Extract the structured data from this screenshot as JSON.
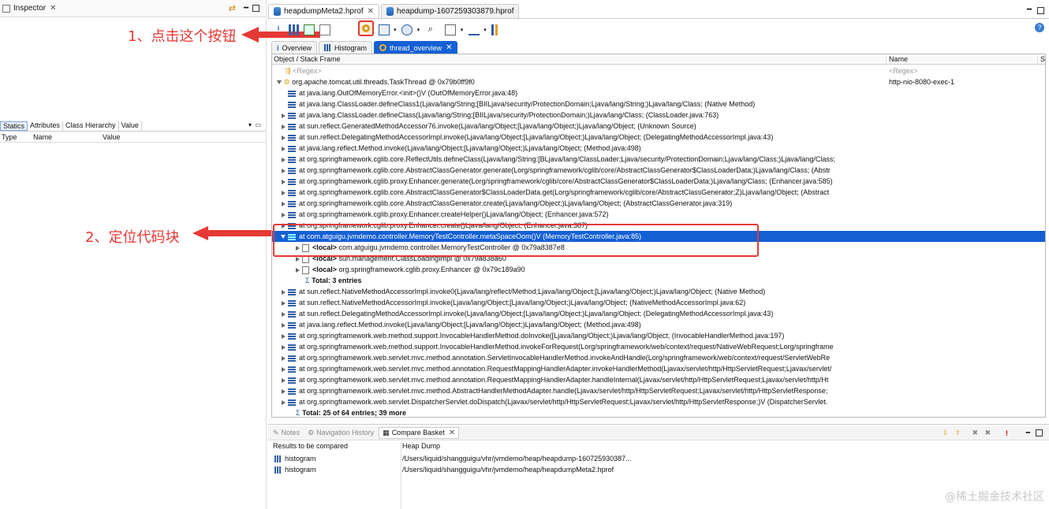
{
  "inspector": {
    "title": "Inspector",
    "tabs": [
      "Statics",
      "Attributes",
      "Class Hierarchy",
      "Value"
    ],
    "columns": [
      "Type",
      "Name",
      "Value"
    ]
  },
  "editor": {
    "file_tabs": [
      "heapdumpMeta2.hprof",
      "heapdump-1607259303879.hprof"
    ],
    "view_tabs": [
      "Overview",
      "Histogram",
      "thread_overview"
    ],
    "columns": {
      "object": "Object / Stack Frame",
      "name": "Name",
      "extra": "S"
    },
    "regex_placeholder": "<Regex>",
    "regex_name_placeholder": "<Regex>",
    "thread": {
      "label": "org.apache.tomcat.util.threads.TaskThread @ 0x79b0ff9f0",
      "name": "http-nio-8080-exec-1"
    },
    "frames_before": [
      "at java.lang.OutOfMemoryError.<init>()V (OutOfMemoryError.java:48)",
      "at java.lang.ClassLoader.defineClass1(Ljava/lang/String;[BIILjava/security/ProtectionDomain;Ljava/lang/String;)Ljava/lang/Class; (Native Method)",
      "at java.lang.ClassLoader.defineClass(Ljava/lang/String;[BIILjava/security/ProtectionDomain;)Ljava/lang/Class; (ClassLoader.java:763)",
      "at sun.reflect.GeneratedMethodAccessor76.invoke(Ljava/lang/Object;[Ljava/lang/Object;)Ljava/lang/Object; (Unknown Source)",
      "at sun.reflect.DelegatingMethodAccessorImpl.invoke(Ljava/lang/Object;[Ljava/lang/Object;)Ljava/lang/Object; (DelegatingMethodAccessorImpl.java:43)",
      "at java.lang.reflect.Method.invoke(Ljava/lang/Object;[Ljava/lang/Object;)Ljava/lang/Object; (Method.java:498)",
      "at org.springframework.cglib.core.ReflectUtils.defineClass(Ljava/lang/String;[BLjava/lang/ClassLoader;Ljava/security/ProtectionDomain;Ljava/lang/Class;)Ljava/lang/Class;",
      "at org.springframework.cglib.core.AbstractClassGenerator.generate(Lorg/springframework/cglib/core/AbstractClassGenerator$ClassLoaderData;)Ljava/lang/Class; (Abstr",
      "at org.springframework.cglib.proxy.Enhancer.generate(Lorg/springframework/cglib/core/AbstractClassGenerator$ClassLoaderData;)Ljava/lang/Class; (Enhancer.java:585)",
      "at org.springframework.cglib.core.AbstractClassGenerator$ClassLoaderData.get(Lorg/springframework/cglib/core/AbstractClassGenerator;Z)Ljava/lang/Object; (Abstract",
      "at org.springframework.cglib.core.AbstractClassGenerator.create(Ljava/lang/Object;)Ljava/lang/Object; (AbstractClassGenerator.java:319)",
      "at org.springframework.cglib.proxy.Enhancer.createHelper()Ljava/lang/Object; (Enhancer.java:572)",
      "at org.springframework.cglib.proxy.Enhancer.create()Ljava/lang/Object; (Enhancer.java:387)"
    ],
    "selected_frame": "at com.atguigu.jvmdemo.controller.MemoryTestController.metaSpaceOom()V (MemoryTestController.java:85)",
    "locals": [
      {
        "tag": "<local>",
        "text": "com.atguigu.jvmdemo.controller.MemoryTestController @ 0x79a8387e8"
      },
      {
        "tag": "<local>",
        "text": "sun.management.ClassLoadingImpl @ 0x79a838a60"
      },
      {
        "tag": "<local>",
        "text": "org.springframework.cglib.proxy.Enhancer @ 0x79c189a90"
      }
    ],
    "locals_total": "Total: 3 entries",
    "frames_after": [
      "at sun.reflect.NativeMethodAccessorImpl.invoke0(Ljava/lang/reflect/Method;Ljava/lang/Object;[Ljava/lang/Object;)Ljava/lang/Object; (Native Method)",
      "at sun.reflect.NativeMethodAccessorImpl.invoke(Ljava/lang/Object;[Ljava/lang/Object;)Ljava/lang/Object; (NativeMethodAccessorImpl.java:62)",
      "at sun.reflect.DelegatingMethodAccessorImpl.invoke(Ljava/lang/Object;[Ljava/lang/Object;)Ljava/lang/Object; (DelegatingMethodAccessorImpl.java:43)",
      "at java.lang.reflect.Method.invoke(Ljava/lang/Object;[Ljava/lang/Object;)Ljava/lang/Object; (Method.java:498)",
      "at org.springframework.web.method.support.InvocableHandlerMethod.doInvoke([Ljava/lang/Object;)Ljava/lang/Object; (InvocableHandlerMethod.java:197)",
      "at org.springframework.web.method.support.InvocableHandlerMethod.invokeForRequest(Lorg/springframework/web/context/request/NativeWebRequest;Lorg/springframe",
      "at org.springframework.web.servlet.mvc.method.annotation.ServletInvocableHandlerMethod.invokeAndHandle(Lorg/springframework/web/context/request/ServletWebRe",
      "at org.springframework.web.servlet.mvc.method.annotation.RequestMappingHandlerAdapter.invokeHandlerMethod(Ljavax/servlet/http/HttpServletRequest;Ljavax/servlet/",
      "at org.springframework.web.servlet.mvc.method.annotation.RequestMappingHandlerAdapter.handleInternal(Ljavax/servlet/http/HttpServletRequest;Ljavax/servlet/http/Ht",
      "at org.springframework.web.servlet.mvc.method.AbstractHandlerMethodAdapter.handle(Ljavax/servlet/http/HttpServletRequest;Ljavax/servlet/http/HttpServletResponse;",
      "at org.springframework.web.servlet.DispatcherServlet.doDispatch(Ljavax/servlet/http/HttpServletRequest;Ljavax/servlet/http/HttpServletResponse;)V (DispatcherServlet."
    ],
    "frames_total": "Total: 25 of 64 entries; 39 more"
  },
  "bottom": {
    "tabs": [
      "Notes",
      "Navigation History",
      "Compare Basket"
    ],
    "columns": [
      "Results to be compared",
      "Heap Dump"
    ],
    "rows": [
      {
        "name": "histogram",
        "path": "/Users/liquid/shangguigu/vhr/jvmdemo/heap/heapdump-160725930387..."
      },
      {
        "name": "histogram",
        "path": "/Users/liquid/shangguigu/vhr/jvmdemo/heap/heapdumpMeta2.hprof"
      }
    ]
  },
  "annotations": {
    "step1": "1、点击这个按钮",
    "step2": "2、定位代码块"
  },
  "watermark": "@稀土掘金技术社区",
  "colors": {
    "selection": "#1460d4",
    "annotation": "#e53935"
  }
}
